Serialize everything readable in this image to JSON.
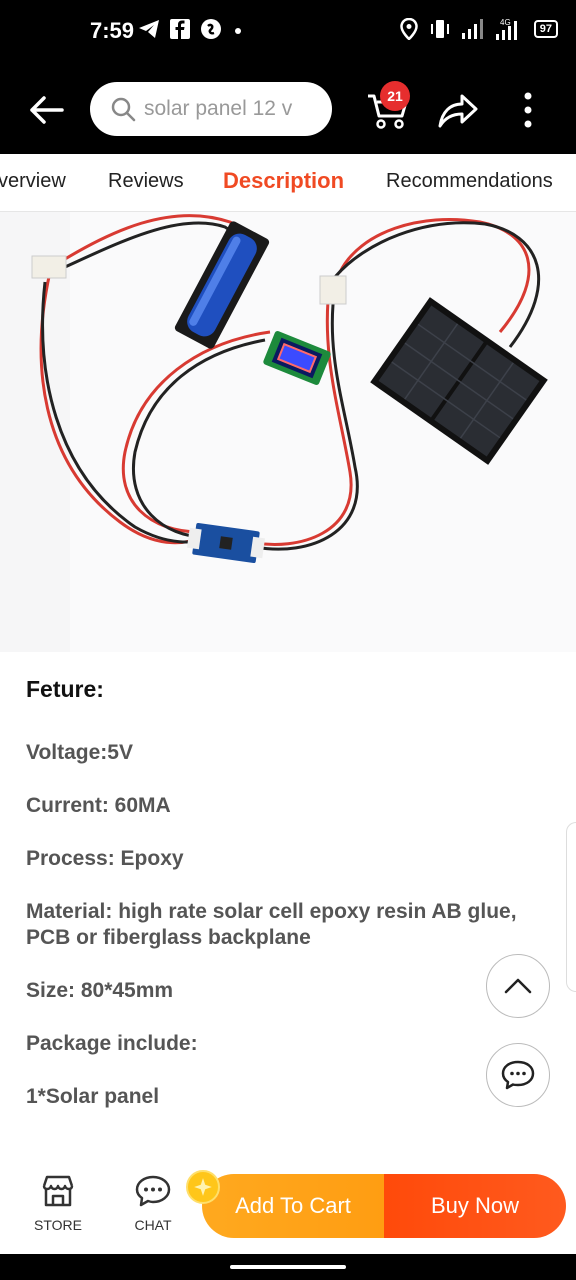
{
  "status": {
    "time": "7:59",
    "battery": "97",
    "network": "4G"
  },
  "header": {
    "search_value": "solar panel 12 v",
    "cart_count": "21"
  },
  "tabs": [
    {
      "label": "verview"
    },
    {
      "label": "Reviews"
    },
    {
      "label": "Description"
    },
    {
      "label": "Recommendations"
    }
  ],
  "description": {
    "heading": "Feture:",
    "lines": [
      "Voltage:5V",
      "Current: 60MA",
      "Process: Epoxy",
      "Material: high rate solar cell epoxy resin AB glue, PCB or fiberglass backplane",
      "Size: 80*45mm",
      "Package include:",
      "1*Solar panel"
    ]
  },
  "bottom": {
    "store_label": "STORE",
    "chat_label": "CHAT",
    "add_to_cart": "Add To Cart",
    "buy_now": "Buy Now"
  },
  "colors": {
    "accent": "#f04a23",
    "add_to_cart": "#ffa91f",
    "buy_now": "#ff4a0a",
    "badge": "#e62e2e"
  },
  "icons": {
    "back": "arrow-left-icon",
    "search": "search-icon",
    "cart": "cart-icon",
    "share": "share-icon",
    "more": "more-vertical-icon",
    "scroll_top": "chevron-up-icon",
    "chat_fab": "chat-bubble-icon",
    "store": "store-icon",
    "chat": "chat-icon"
  }
}
